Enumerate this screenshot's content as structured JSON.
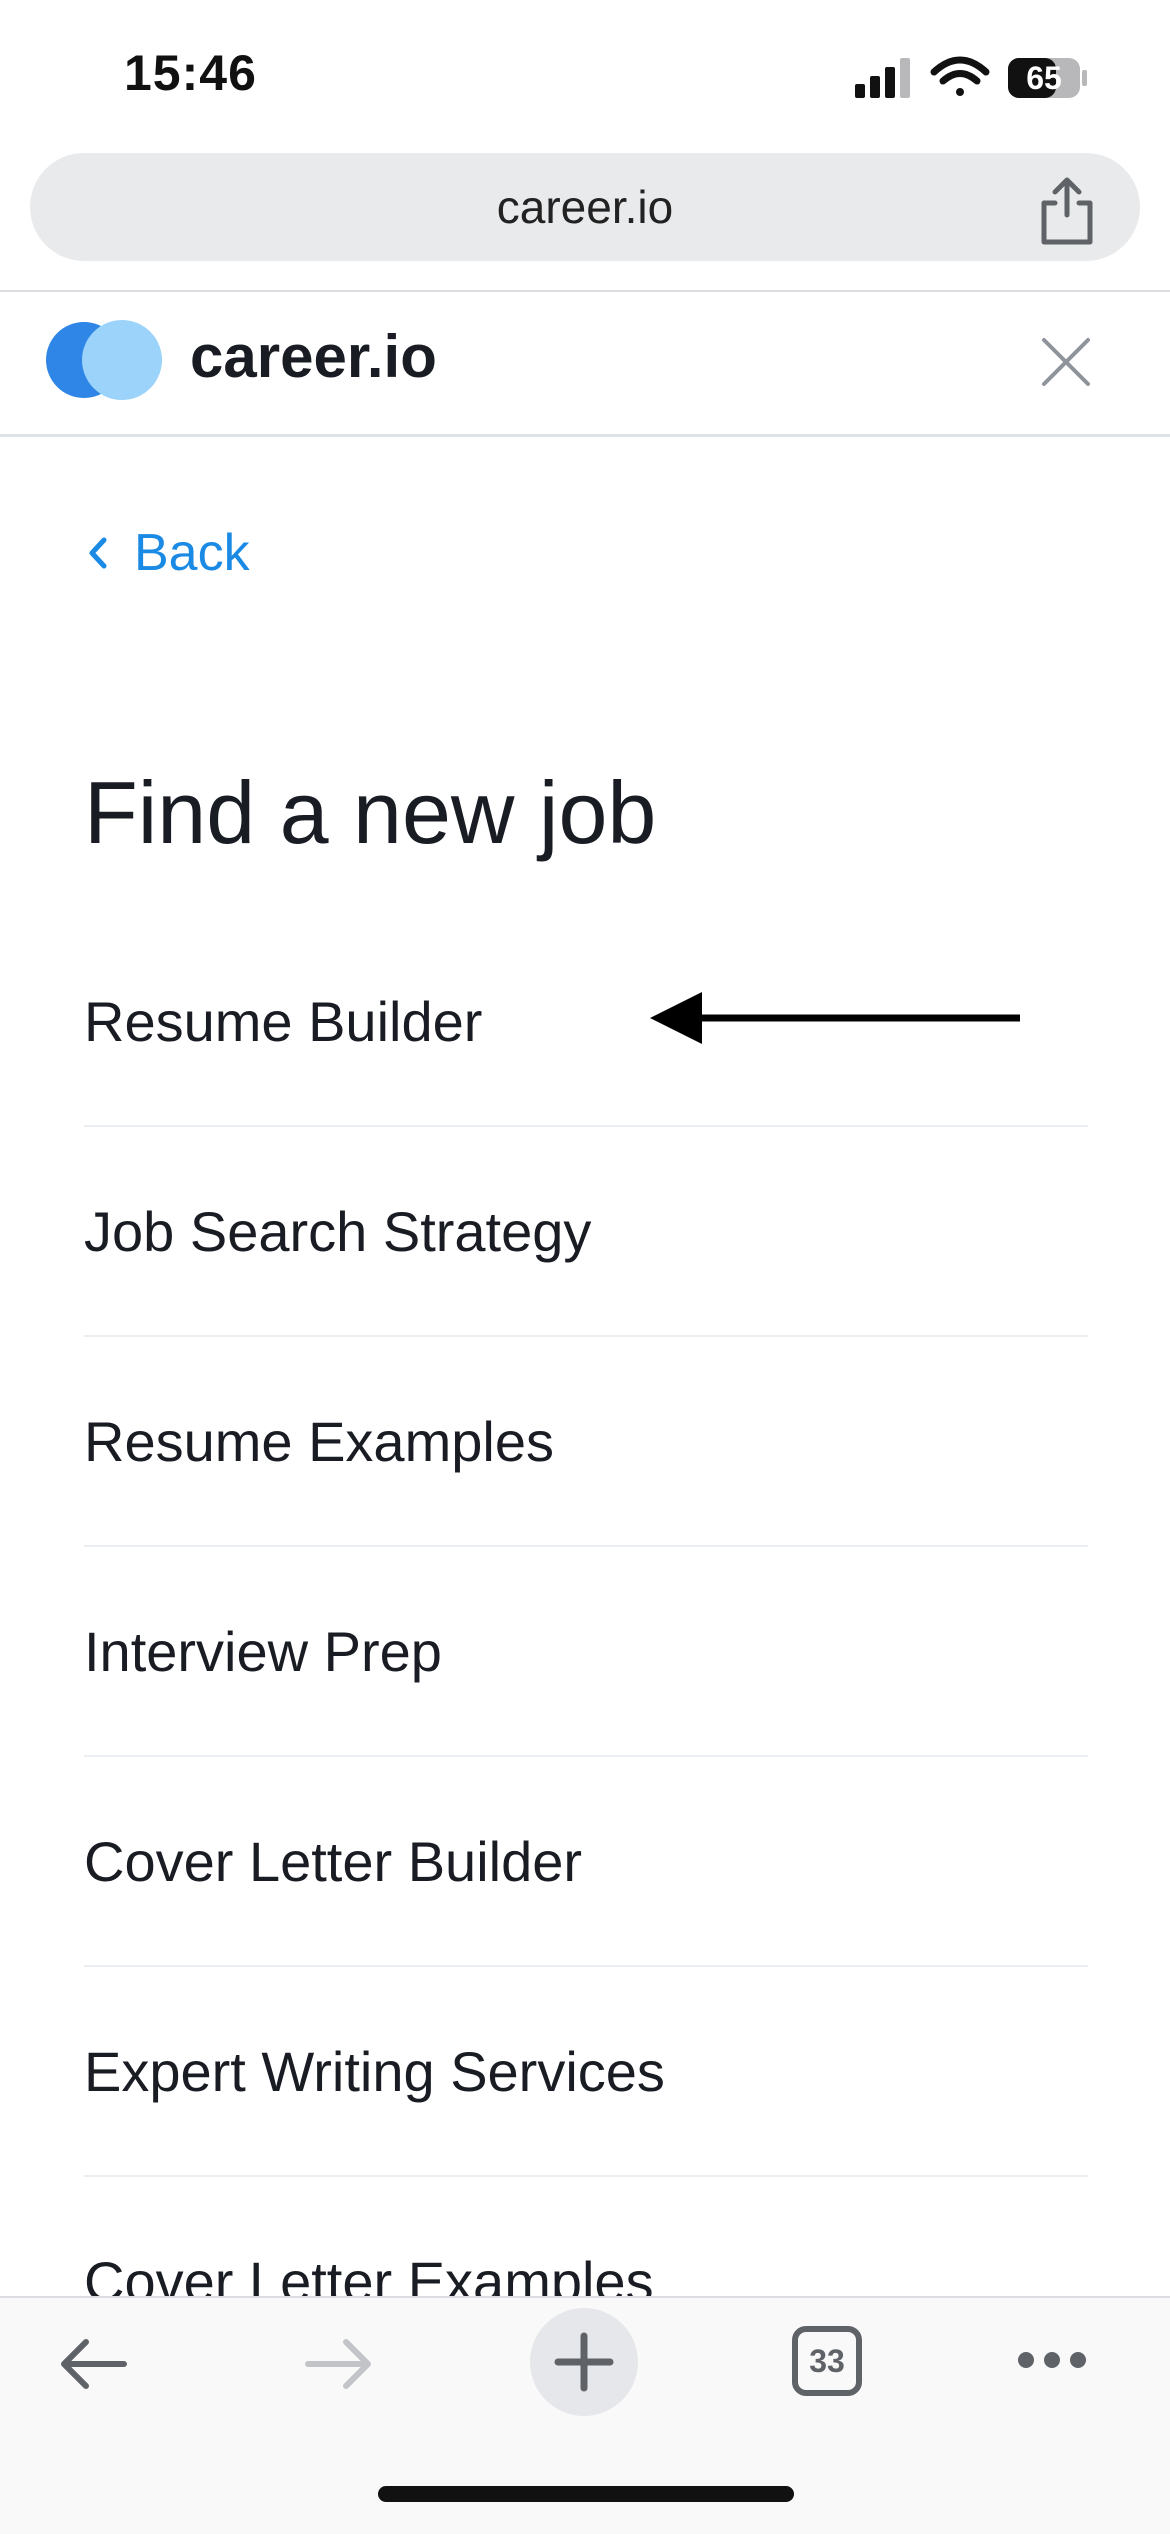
{
  "status_bar": {
    "time": "15:46",
    "battery": "65"
  },
  "browser": {
    "url": "career.io",
    "tab_count": "33"
  },
  "site": {
    "brand": "career.io"
  },
  "nav": {
    "back_label": "Back"
  },
  "page": {
    "title": "Find a new job"
  },
  "menu": {
    "items": [
      {
        "label": "Resume Builder"
      },
      {
        "label": "Job Search Strategy"
      },
      {
        "label": "Resume Examples"
      },
      {
        "label": "Interview Prep"
      },
      {
        "label": "Cover Letter Builder"
      },
      {
        "label": "Expert Writing Services"
      },
      {
        "label": "Cover Letter Examples"
      }
    ]
  },
  "colors": {
    "accent": "#1a8ae5",
    "logo_dark": "#2f86e6",
    "logo_light": "#9bd3fb"
  },
  "icons": [
    "signal-icon",
    "wifi-icon",
    "battery-icon",
    "share-icon",
    "close-icon",
    "chevron-left-icon",
    "back-arrow-icon",
    "forward-arrow-icon",
    "plus-icon",
    "tabs-icon",
    "more-icon"
  ]
}
